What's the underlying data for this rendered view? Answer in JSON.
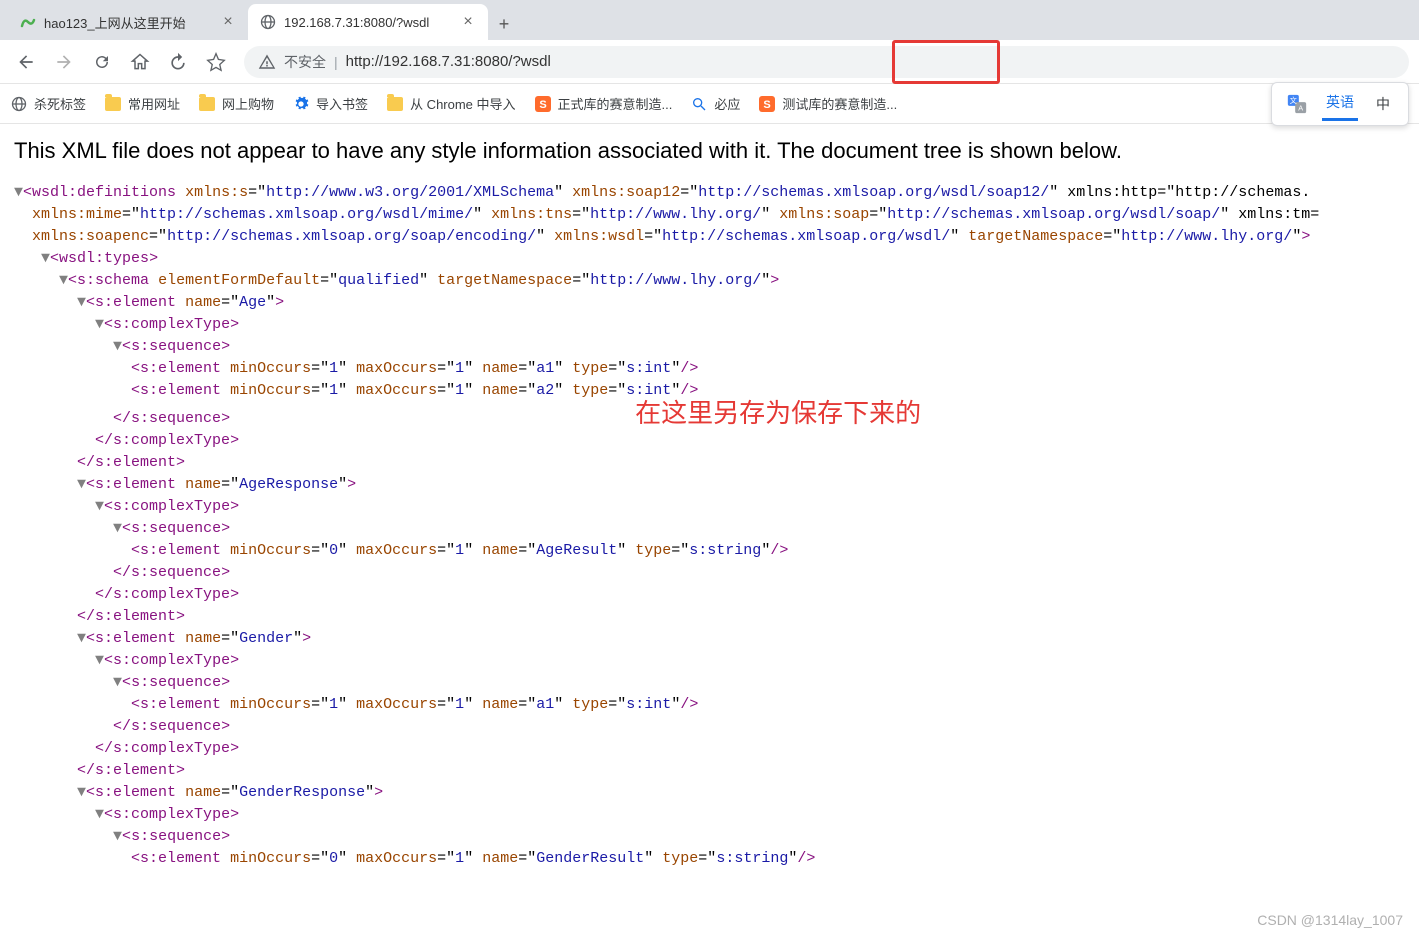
{
  "tabs": [
    {
      "title": "hao123_上网从这里开始",
      "active": false
    },
    {
      "title": "192.168.7.31:8080/?wsdl",
      "active": true
    }
  ],
  "toolbar": {
    "not_secure": "不安全",
    "url": "http://192.168.7.31:8080/?wsdl"
  },
  "bookmarks": {
    "items": [
      {
        "label": "杀死标签",
        "icon": "globe"
      },
      {
        "label": "常用网址",
        "icon": "folder"
      },
      {
        "label": "网上购物",
        "icon": "folder"
      },
      {
        "label": "导入书签",
        "icon": "gear"
      },
      {
        "label": "从 Chrome 中导入",
        "icon": "folder"
      },
      {
        "label": "正式库的赛意制造...",
        "icon": "s-orange"
      },
      {
        "label": "必应",
        "icon": "search"
      },
      {
        "label": "测试库的赛意制造...",
        "icon": "s-orange"
      }
    ],
    "translate_active": "英语",
    "translate_other": "中"
  },
  "content": {
    "notice": "This XML file does not appear to have any style information associated with it. The document tree is shown below.",
    "annotation": "在这里另存为保存下来的",
    "watermark": "CSDN @1314lay_1007"
  },
  "xml": {
    "def_open": "wsdl:definitions",
    "def_attrs_l1": "xmlns:s=\"http://www.w3.org/2001/XMLSchema\" xmlns:soap12=\"http://schemas.xmlsoap.org/wsdl/soap12/\" xmlns:http=\"http://schemas.",
    "def_attrs_l2": "xmlns:mime=\"http://schemas.xmlsoap.org/wsdl/mime/\" xmlns:tns=\"http://www.lhy.org/\" xmlns:soap=\"http://schemas.xmlsoap.org/wsdl/soap/\" xmlns:tm=",
    "def_attrs_l3": "xmlns:soapenc=\"http://schemas.xmlsoap.org/soap/encoding/\" xmlns:wsdl=\"http://schemas.xmlsoap.org/wsdl/\" targetNamespace=\"http://www.lhy.org/\"",
    "types": "wsdl:types",
    "schema_open": "s:schema",
    "schema_attrs": "elementFormDefault=\"qualified\" targetNamespace=\"http://www.lhy.org/\"",
    "el": "s:element",
    "ct": "s:complexType",
    "seq": "s:sequence",
    "el_age": "name=\"Age\"",
    "el_a1": "minOccurs=\"1\" maxOccurs=\"1\" name=\"a1\" type=\"s:int\"",
    "el_a2": "minOccurs=\"1\" maxOccurs=\"1\" name=\"a2\" type=\"s:int\"",
    "el_age_resp": "name=\"AgeResponse\"",
    "el_age_result": "minOccurs=\"0\" maxOccurs=\"1\" name=\"AgeResult\" type=\"s:string\"",
    "el_gender": "name=\"Gender\"",
    "el_gender_a1": "minOccurs=\"1\" maxOccurs=\"1\" name=\"a1\" type=\"s:int\"",
    "el_gender_resp": "name=\"GenderResponse\"",
    "el_gender_result": "minOccurs=\"0\" maxOccurs=\"1\" name=\"GenderResult\" type=\"s:string\""
  }
}
